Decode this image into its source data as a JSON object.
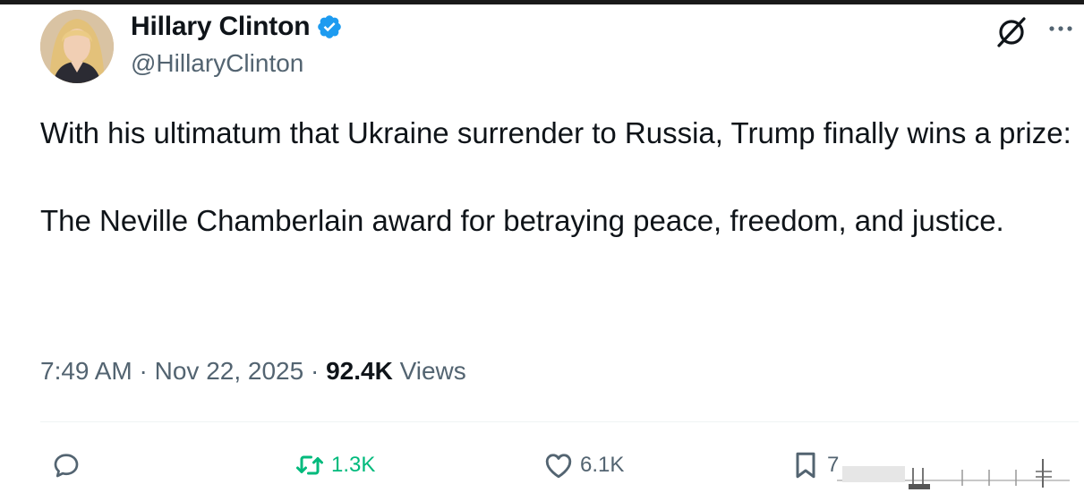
{
  "author": {
    "display_name": "Hillary Clinton",
    "handle": "@HillaryClinton",
    "verified": true
  },
  "tweet": {
    "paragraphs": [
      "With his ultimatum that Ukraine surrender to Russia, Trump finally wins a prize:",
      "The Neville Chamberlain award for betraying peace, freedom, and justice."
    ],
    "time": "7:49 AM",
    "date": "Nov 22, 2025",
    "separator": " · ",
    "views_count": "92.4K",
    "views_label": " Views"
  },
  "actions": {
    "retweets": "1.3K",
    "likes": "6.1K",
    "bookmarks": "7"
  },
  "icons": {
    "verified": "verified-badge-icon",
    "grok": "grok-icon",
    "more": "more-icon",
    "reply": "reply-icon",
    "retweet": "retweet-icon",
    "like": "heart-icon",
    "bookmark": "bookmark-icon"
  },
  "colors": {
    "verified_blue": "#1d9bf0",
    "retweet_green": "#00ba7c",
    "secondary_text": "#536471"
  }
}
